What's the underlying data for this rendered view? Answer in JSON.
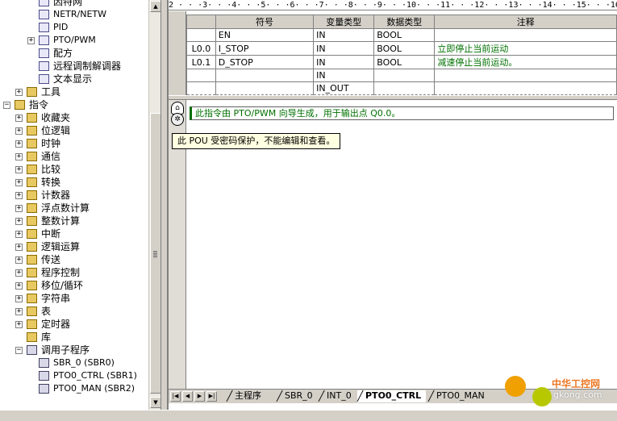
{
  "tree": {
    "items": [
      {
        "label": "因特网",
        "indent": 3,
        "icon": "internet-icon",
        "expander": ""
      },
      {
        "label": "NETR/NETW",
        "indent": 3,
        "icon": "netr-netw-icon",
        "expander": ""
      },
      {
        "label": "PID",
        "indent": 3,
        "icon": "pid-icon",
        "expander": ""
      },
      {
        "label": "PTO/PWM",
        "indent": 3,
        "icon": "pto-pwm-icon",
        "expander": "+"
      },
      {
        "label": "配方",
        "indent": 3,
        "icon": "recipe-icon",
        "expander": ""
      },
      {
        "label": "远程调制解调器",
        "indent": 3,
        "icon": "modem-icon",
        "expander": ""
      },
      {
        "label": "文本显示",
        "indent": 3,
        "icon": "text-display-icon",
        "expander": ""
      },
      {
        "label": "工具",
        "indent": 2,
        "icon": "tools-icon",
        "expander": "+"
      },
      {
        "label": "指令",
        "indent": 1,
        "icon": "instructions-icon",
        "expander": "-"
      },
      {
        "label": "收藏夹",
        "indent": 2,
        "icon": "favorites-icon",
        "expander": "+"
      },
      {
        "label": "位逻辑",
        "indent": 2,
        "icon": "bit-logic-icon",
        "expander": "+"
      },
      {
        "label": "时钟",
        "indent": 2,
        "icon": "clock-icon",
        "expander": "+"
      },
      {
        "label": "通信",
        "indent": 2,
        "icon": "communication-icon",
        "expander": "+"
      },
      {
        "label": "比较",
        "indent": 2,
        "icon": "compare-icon",
        "expander": "+"
      },
      {
        "label": "转换",
        "indent": 2,
        "icon": "convert-icon",
        "expander": "+"
      },
      {
        "label": "计数器",
        "indent": 2,
        "icon": "counter-icon",
        "expander": "+"
      },
      {
        "label": "浮点数计算",
        "indent": 2,
        "icon": "float-math-icon",
        "expander": "+"
      },
      {
        "label": "整数计算",
        "indent": 2,
        "icon": "integer-math-icon",
        "expander": "+"
      },
      {
        "label": "中断",
        "indent": 2,
        "icon": "interrupt-icon",
        "expander": "+"
      },
      {
        "label": "逻辑运算",
        "indent": 2,
        "icon": "logic-ops-icon",
        "expander": "+"
      },
      {
        "label": "传送",
        "indent": 2,
        "icon": "move-icon",
        "expander": "+"
      },
      {
        "label": "程序控制",
        "indent": 2,
        "icon": "program-control-icon",
        "expander": "+"
      },
      {
        "label": "移位/循环",
        "indent": 2,
        "icon": "shift-rotate-icon",
        "expander": "+"
      },
      {
        "label": "字符串",
        "indent": 2,
        "icon": "string-icon",
        "expander": "+"
      },
      {
        "label": "表",
        "indent": 2,
        "icon": "table-icon",
        "expander": "+"
      },
      {
        "label": "定时器",
        "indent": 2,
        "icon": "timer-icon",
        "expander": "+"
      },
      {
        "label": "库",
        "indent": 2,
        "icon": "library-icon",
        "expander": ""
      },
      {
        "label": "调用子程序",
        "indent": 2,
        "icon": "call-subroutine-icon",
        "expander": "-"
      },
      {
        "label": "SBR_0 (SBR0)",
        "indent": 3,
        "icon": "subroutine-icon",
        "expander": ""
      },
      {
        "label": "PTO0_CTRL (SBR1)",
        "indent": 3,
        "icon": "locked-subroutine-icon",
        "expander": ""
      },
      {
        "label": "PTO0_MAN (SBR2)",
        "indent": 3,
        "icon": "locked-subroutine-icon",
        "expander": ""
      }
    ]
  },
  "ruler": {
    "text": "2 · · ·3· · ·4· · ·5· · ·6· · ·7· · ·8· · ·9· · ·10· · ·11· · ·12· · ·13· · ·14· · ·15· · ·16·"
  },
  "var_table": {
    "headers": [
      "",
      "符号",
      "变量类型",
      "数据类型",
      "注释"
    ],
    "rows": [
      {
        "address": "",
        "symbol": "EN",
        "var_type": "IN",
        "data_type": "BOOL",
        "comment": ""
      },
      {
        "address": "L0.0",
        "symbol": "I_STOP",
        "var_type": "IN",
        "data_type": "BOOL",
        "comment": "立即停止当前运动"
      },
      {
        "address": "L0.1",
        "symbol": "D_STOP",
        "var_type": "IN",
        "data_type": "BOOL",
        "comment": "减速停止当前运动。"
      },
      {
        "address": "",
        "symbol": "",
        "var_type": "IN",
        "data_type": "",
        "comment": ""
      },
      {
        "address": "",
        "symbol": "",
        "var_type": "IN_OUT",
        "data_type": "",
        "comment": ""
      }
    ]
  },
  "code": {
    "program_comment": "此指令由 PTO/PWM 向导生成，用于输出点 Q0.0。",
    "protection_tooltip": "此 POU 受密码保护，不能编辑和查看。"
  },
  "tabs": {
    "items": [
      "主程序",
      "SBR_0",
      "INT_0",
      "PTO0_CTRL",
      "PTO0_MAN"
    ],
    "active": "PTO0_CTRL"
  },
  "watermark": {
    "cn": "中华工控网",
    "url": "gkong.com"
  },
  "colors": {
    "comment_green": "#007000",
    "tooltip_bg": "#ffffe1",
    "chrome": "#d4d0c8"
  }
}
